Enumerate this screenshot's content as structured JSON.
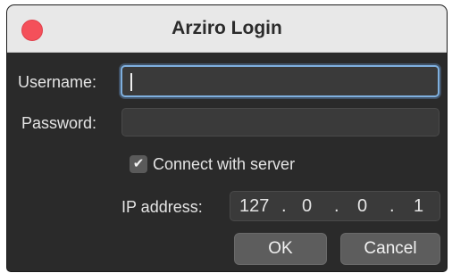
{
  "window": {
    "title": "Arziro Login"
  },
  "form": {
    "username_label": "Username:",
    "username_value": "",
    "password_label": "Password:",
    "password_value": "",
    "connect_label": "Connect with server",
    "connect_checked": true,
    "connect_check_glyph": "✔",
    "ip_label": "IP address:",
    "ip_octets": [
      "127",
      "0",
      "0",
      "1"
    ],
    "ip_separator": "."
  },
  "buttons": {
    "ok_label": "OK",
    "cancel_label": "Cancel"
  },
  "colors": {
    "background": "#2a2a2a",
    "titlebar": "#e8e8e8",
    "close": "#f4505a",
    "focus_ring": "#7fb0df"
  }
}
